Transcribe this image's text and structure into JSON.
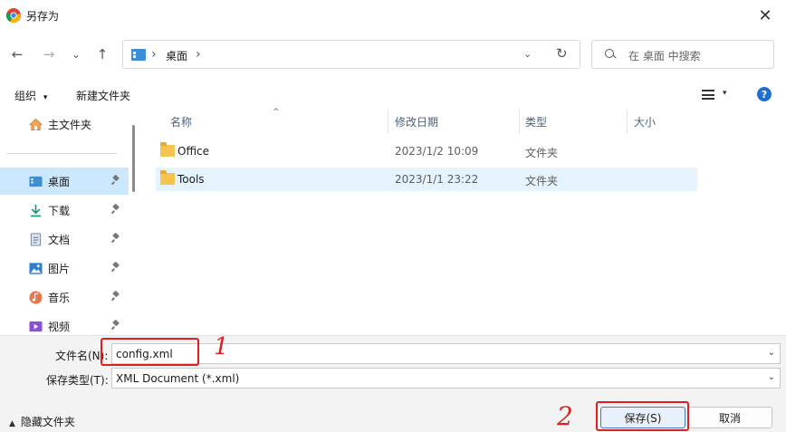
{
  "window": {
    "title": "另存为",
    "close_glyph": "✕"
  },
  "nav": {
    "back_glyph": "←",
    "forward_glyph": "→",
    "recent_glyph": "⌄",
    "up_glyph": "↑",
    "address": {
      "separator": "›",
      "current": "桌面",
      "dropdown_glyph": "⌄",
      "refresh_glyph": "↻"
    },
    "search_placeholder": "在 桌面 中搜索"
  },
  "toolbar": {
    "organize": "组织",
    "organize_arrow": "▾",
    "new_folder": "新建文件夹",
    "view_arrow": "▾",
    "help": "?"
  },
  "sidebar": {
    "items": [
      {
        "label": "主文件夹",
        "icon": "home-icon"
      },
      {
        "label": "桌面",
        "icon": "desktop-icon",
        "active": true,
        "pinned": true
      },
      {
        "label": "下载",
        "icon": "download-icon",
        "pinned": true
      },
      {
        "label": "文档",
        "icon": "document-icon",
        "pinned": true
      },
      {
        "label": "图片",
        "icon": "picture-icon",
        "pinned": true
      },
      {
        "label": "音乐",
        "icon": "music-icon",
        "pinned": true
      },
      {
        "label": "视频",
        "icon": "video-icon",
        "pinned": true
      }
    ]
  },
  "list": {
    "columns": {
      "name": "名称",
      "modified": "修改日期",
      "type": "类型",
      "size": "大小"
    },
    "sort_glyph": "^",
    "rows": [
      {
        "name": "Office",
        "modified": "2023/1/2 10:09",
        "type": "文件夹",
        "size": ""
      },
      {
        "name": "Tools",
        "modified": "2023/1/1 23:22",
        "type": "文件夹",
        "size": "",
        "selected": true
      }
    ]
  },
  "form": {
    "filename_label": "文件名(N):",
    "filename_value": "config.xml",
    "filetype_label": "保存类型(T):",
    "filetype_value": "XML Document (*.xml)",
    "dropdown_glyph": "⌄"
  },
  "footer": {
    "hide_folders": "隐藏文件夹",
    "hide_arrow": "▲",
    "save": "保存(S)",
    "cancel": "取消"
  },
  "annotations": {
    "step1": "1",
    "step2": "2",
    "color": "#e02020"
  }
}
